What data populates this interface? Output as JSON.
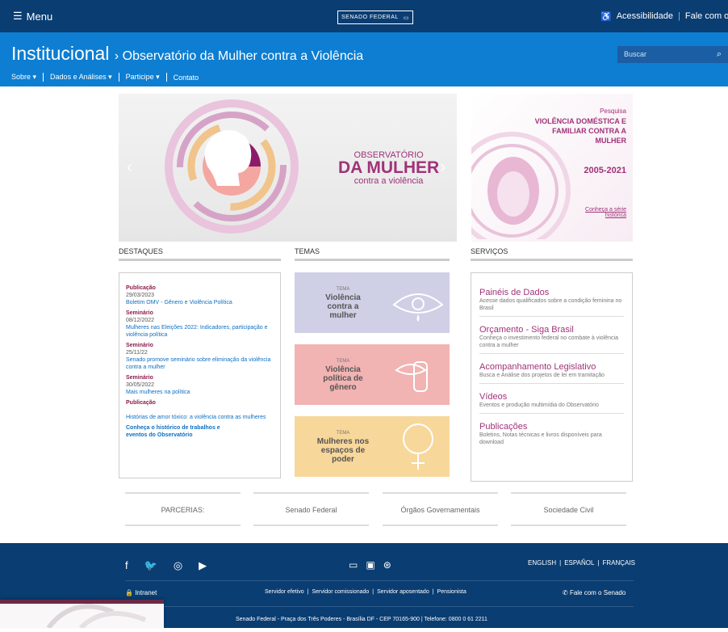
{
  "topbar": {
    "menu_label": "Menu",
    "senado_tag": "SENADO FEDERAL",
    "accessibility": "Acessibilidade",
    "contact": "Fale com o Senado"
  },
  "header": {
    "section": "Institucional",
    "page_title": "Observatório da Mulher contra a Violência",
    "search_placeholder": "Buscar"
  },
  "nav": [
    {
      "label": "Sobre ▾"
    },
    {
      "label": "Dados e Análises ▾"
    },
    {
      "label": "Participe ▾"
    },
    {
      "label": "Contato"
    }
  ],
  "hero": {
    "line1": "OBSERVATÓRIO",
    "line2": "DA MULHER",
    "line3": "contra a violência"
  },
  "promo": {
    "kicker": "Pesquisa",
    "title": "VIOLÊNCIA DOMÉSTICA E FAMILIAR CONTRA A MULHER",
    "years": "2005-2021",
    "link": "Conheça a série histórica"
  },
  "sections": {
    "destaques": "DESTAQUES",
    "temas": "TEMAS",
    "servicos": "SERVIÇOS"
  },
  "destaques": [
    {
      "cat": "Publicação",
      "date": "29/03/2023",
      "text": "Boletim OMV - Gênero e Violência Política"
    },
    {
      "cat": "Seminário",
      "date": "08/12/2022",
      "text": "Mulheres nas Eleições 2022: Indicadores, participação e violência política"
    },
    {
      "cat": "Seminário",
      "date": "25/11/22",
      "text": "Senado promove seminário sobre eliminação da violência contra a mulher"
    },
    {
      "cat": "Seminário",
      "date": "30/05/2022",
      "text": "Mais mulheres na política"
    },
    {
      "cat": "Publicação",
      "date": "",
      "text": "Histórias de amor tóxico: a violência contra as mulheres"
    }
  ],
  "destaques_link": "Conheça o histórico de trabalhos e eventos do Observatório",
  "temas": [
    {
      "tag": "TEMA",
      "name": "Violência contra a mulher",
      "bg": "#cfcfe6"
    },
    {
      "tag": "TEMA",
      "name": "Violência política de gênero",
      "bg": "#f2b3b3"
    },
    {
      "tag": "TEMA",
      "name": "Mulheres nos espaços de poder",
      "bg": "#f8d79a"
    }
  ],
  "servicos": [
    {
      "title": "Painéis de Dados",
      "desc": "Acesse dados qualificados sobre a condição feminina no Brasil"
    },
    {
      "title": "Orçamento - Siga Brasil",
      "desc": "Conheça o investimento federal no combate à violência contra a mulher"
    },
    {
      "title": "Acompanhamento Legislativo",
      "desc": "Busca e Análise dos projetos de lei em tramitação"
    },
    {
      "title": "Vídeos",
      "desc": "Eventos e produção multimídia do Observatório"
    },
    {
      "title": "Publicações",
      "desc": "Boletins, Notas técnicas e livros disponíveis para download"
    }
  ],
  "parcerias": [
    "PARCERIAS:",
    "Senado Federal",
    "Órgãos Governamentais",
    "Sociedade Civil"
  ],
  "footer": {
    "langs": [
      "ENGLISH",
      "ESPAÑOL",
      "FRANÇAIS"
    ],
    "intranet": "Intranet",
    "servidor": [
      "Servidor efetivo",
      "Servidor comissionado",
      "Servidor aposentado",
      "Pensionista"
    ],
    "fale": "Fale com o Senado",
    "address": "Senado Federal - Praça dos Três Poderes - Brasília DF - CEP 70165-900 | Telefone: 0800 0 61 2211"
  }
}
